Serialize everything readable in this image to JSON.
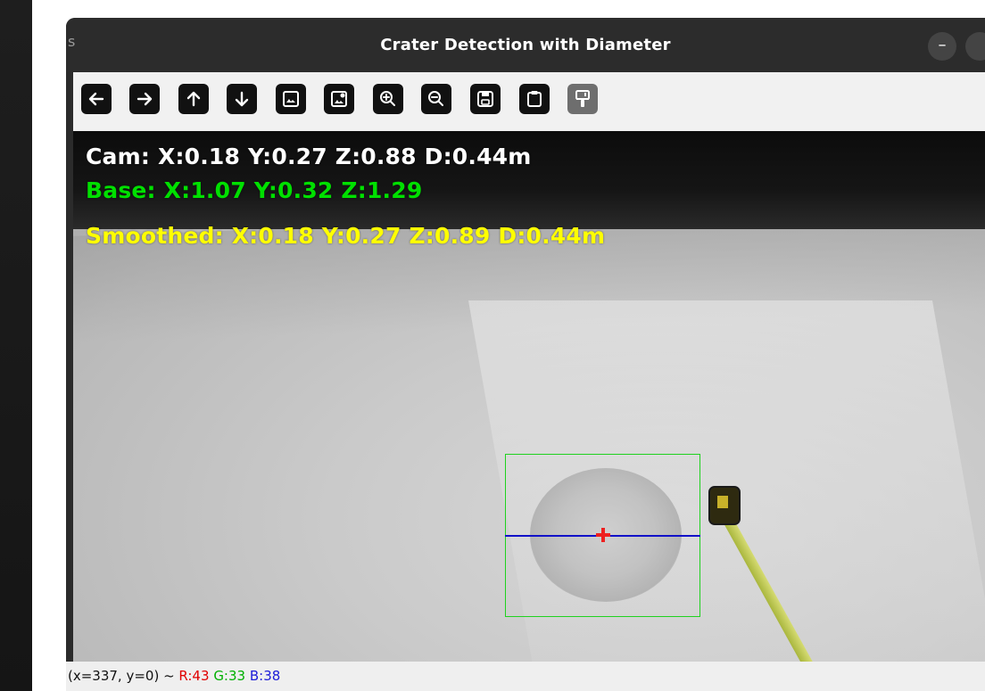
{
  "window": {
    "title": "Crater Detection with Diameter",
    "minimize_symbol": "–",
    "side_glyph": "s"
  },
  "toolbar": {
    "buttons": [
      {
        "icon": "arrow-left-icon"
      },
      {
        "icon": "arrow-right-icon"
      },
      {
        "icon": "arrow-up-icon"
      },
      {
        "icon": "arrow-down-icon"
      },
      {
        "icon": "image-icon"
      },
      {
        "icon": "image-settings-icon"
      },
      {
        "icon": "zoom-in-icon"
      },
      {
        "icon": "zoom-out-icon"
      },
      {
        "icon": "save-icon"
      },
      {
        "icon": "clipboard-icon"
      },
      {
        "icon": "paint-brush-icon",
        "disabled": true
      }
    ]
  },
  "overlay": {
    "cam": "Cam: X:0.18 Y:0.27 Z:0.88 D:0.44m",
    "base": "Base: X:1.07 Y:0.32 Z:1.29",
    "smoothed": "Smoothed: X:0.18 Y:0.27 Z:0.89 D:0.44m",
    "colors": {
      "cam": "#ffffff",
      "base": "#00e000",
      "smoothed": "#ffff00",
      "bbox": "#1fd21f",
      "diameter_line": "#1111c8",
      "center_marker": "#ee2020"
    }
  },
  "status": {
    "coords": "(x=337, y=0) ~ ",
    "r": "R:43",
    "g": "G:33",
    "b": "B:38"
  }
}
